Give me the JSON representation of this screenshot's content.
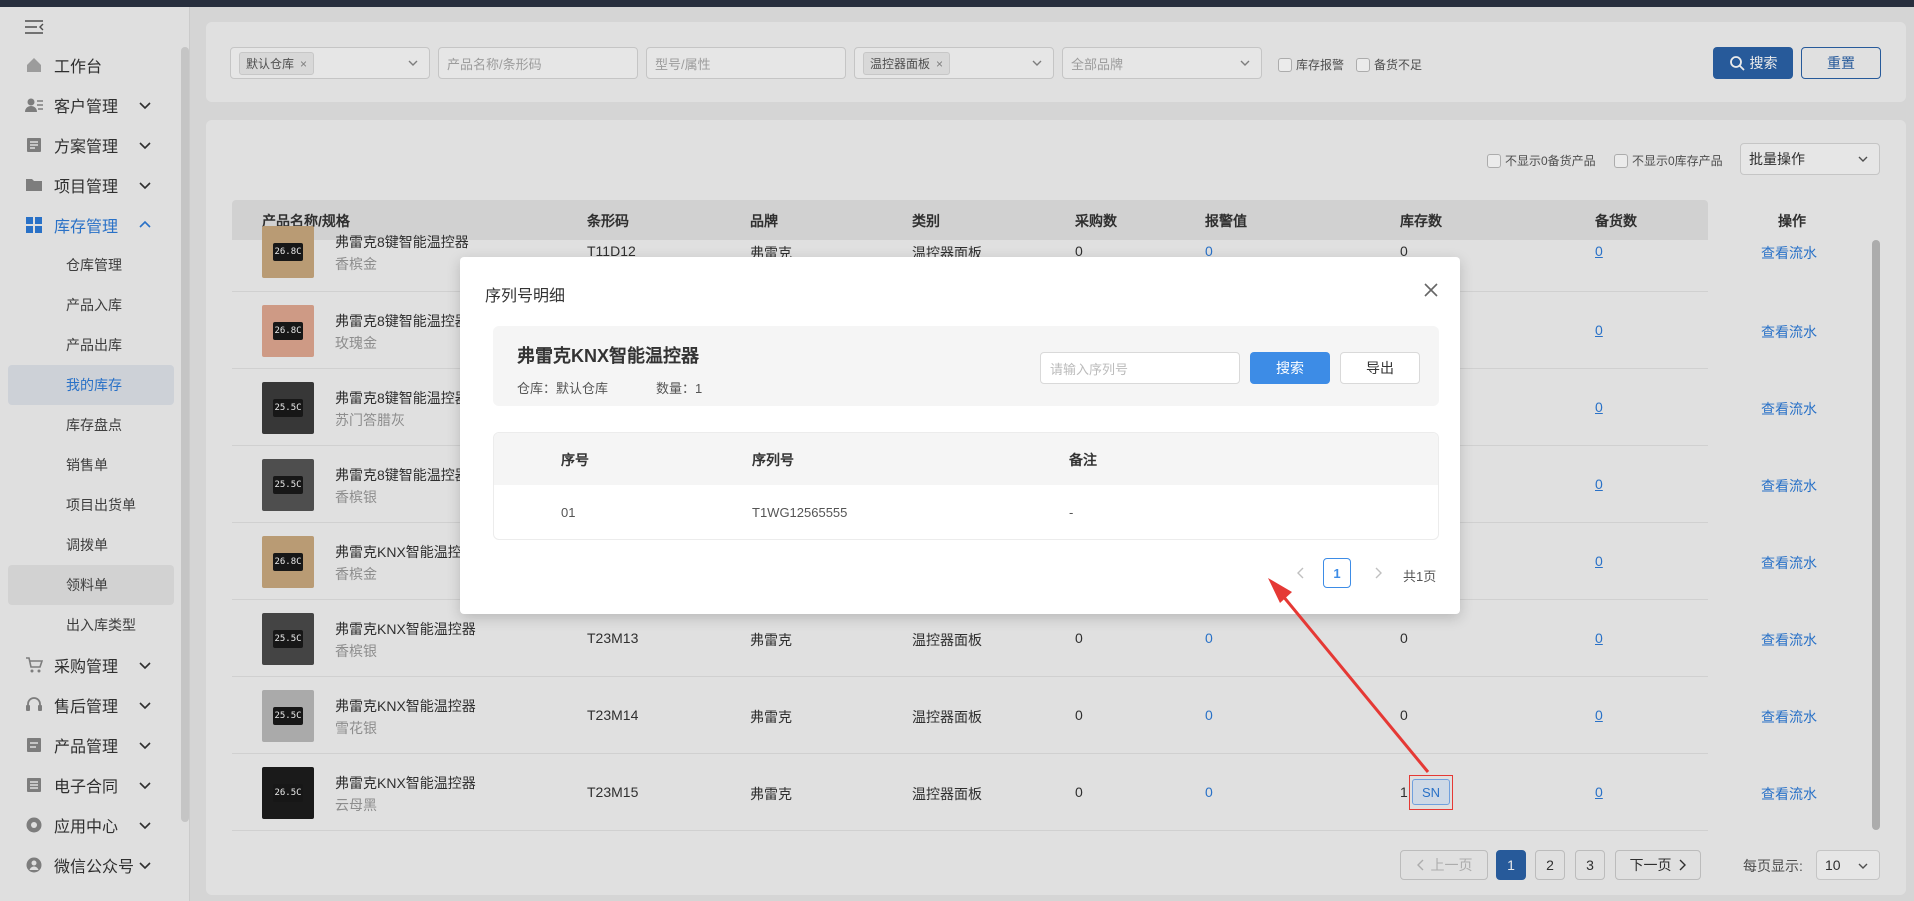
{
  "sidebar": {
    "menu": [
      {
        "label": "工作台",
        "icon": "home-icon",
        "has_chevron": false
      },
      {
        "label": "客户管理",
        "icon": "customer-icon",
        "has_chevron": true
      },
      {
        "label": "方案管理",
        "icon": "plan-icon",
        "has_chevron": true
      },
      {
        "label": "项目管理",
        "icon": "folder-icon",
        "has_chevron": true
      },
      {
        "label": "库存管理",
        "icon": "inventory-icon",
        "has_chevron": true,
        "expanded": true
      }
    ],
    "submenu": [
      {
        "label": "仓库管理"
      },
      {
        "label": "产品入库"
      },
      {
        "label": "产品出库"
      },
      {
        "label": "我的库存",
        "selected": true
      },
      {
        "label": "库存盘点"
      },
      {
        "label": "销售单"
      },
      {
        "label": "项目出货单"
      },
      {
        "label": "调拨单"
      },
      {
        "label": "领料单",
        "hover": true
      },
      {
        "label": "出入库类型"
      }
    ],
    "menu2": [
      {
        "label": "采购管理",
        "icon": "cart-icon"
      },
      {
        "label": "售后管理",
        "icon": "headset-icon"
      },
      {
        "label": "产品管理",
        "icon": "product-icon"
      },
      {
        "label": "电子合同",
        "icon": "contract-icon"
      },
      {
        "label": "应用中心",
        "icon": "app-icon"
      },
      {
        "label": "微信公众号",
        "icon": "wechat-icon"
      }
    ]
  },
  "filters": {
    "warehouse_tag": "默认仓库",
    "product_placeholder": "产品名称/条形码",
    "model_placeholder": "型号/属性",
    "category_tag": "温控器面板",
    "brand_placeholder": "全部品牌",
    "stock_alarm": "库存报警",
    "stock_short": "备货不足",
    "search_label": "搜索",
    "reset_label": "重置"
  },
  "list_options": {
    "hide_zero_reserve": "不显示0备货产品",
    "hide_zero_stock": "不显示0库存产品",
    "batch_label": "批量操作"
  },
  "table": {
    "headers": [
      "产品名称/规格",
      "条形码",
      "品牌",
      "类别",
      "采购数",
      "报警值",
      "库存数",
      "备货数",
      "操作"
    ],
    "rows": [
      {
        "name": "弗雷克8键智能温控器",
        "spec": "香槟金",
        "barcode": "T11D12",
        "brand": "弗雷克",
        "category": "温控器面板",
        "purchase": "0",
        "alarm": "0",
        "stock": "0",
        "reserve": "0",
        "action": "查看流水",
        "thumb_color": "#c9a97e",
        "display": "26.8C"
      },
      {
        "name": "弗雷克8键智能温控器",
        "spec": "玫瑰金",
        "barcode": "",
        "brand": "",
        "category": "",
        "purchase": "",
        "alarm": "",
        "stock": "",
        "reserve": "0",
        "action": "查看流水",
        "thumb_color": "#e0a891",
        "display": "26.8C"
      },
      {
        "name": "弗雷克8键智能温控器",
        "spec": "苏门答腊灰",
        "barcode": "",
        "brand": "",
        "category": "",
        "purchase": "",
        "alarm": "",
        "stock": "",
        "reserve": "0",
        "action": "查看流水",
        "thumb_color": "#3c3c3c",
        "display": "25.5C"
      },
      {
        "name": "弗雷克8键智能温控器",
        "spec": "香槟银",
        "barcode": "",
        "brand": "",
        "category": "",
        "purchase": "",
        "alarm": "",
        "stock": "",
        "reserve": "0",
        "action": "查看流水",
        "thumb_color": "#555555",
        "display": "25.5C"
      },
      {
        "name": "弗雷克KNX智能温控器",
        "spec": "香槟金",
        "barcode": "",
        "brand": "",
        "category": "",
        "purchase": "",
        "alarm": "",
        "stock": "",
        "reserve": "0",
        "action": "查看流水",
        "thumb_color": "#c9a97e",
        "display": "26.8C"
      },
      {
        "name": "弗雷克KNX智能温控器",
        "spec": "香槟银",
        "barcode": "T23M13",
        "brand": "弗雷克",
        "category": "温控器面板",
        "purchase": "0",
        "alarm": "0",
        "stock": "0",
        "reserve": "0",
        "action": "查看流水",
        "thumb_color": "#4a4a4a",
        "display": "25.5C"
      },
      {
        "name": "弗雷克KNX智能温控器",
        "spec": "雪花银",
        "barcode": "T23M14",
        "brand": "弗雷克",
        "category": "温控器面板",
        "purchase": "0",
        "alarm": "0",
        "stock": "0",
        "reserve": "0",
        "action": "查看流水",
        "thumb_color": "#b9b9b9",
        "display": "25.5C"
      },
      {
        "name": "弗雷克KNX智能温控器",
        "spec": "云母黑",
        "barcode": "T23M15",
        "brand": "弗雷克",
        "category": "温控器面板",
        "purchase": "0",
        "alarm": "0",
        "stock": "1",
        "reserve": "0",
        "action": "查看流水",
        "thumb_color": "#1d1d1d",
        "display": "26.5C"
      }
    ],
    "sn_label": "SN"
  },
  "pagination": {
    "prev": "上一页",
    "pages": [
      "1",
      "2",
      "3"
    ],
    "next": "下一页",
    "per_page_label": "每页显示:",
    "per_page_value": "10"
  },
  "modal": {
    "title": "序列号明细",
    "product_name": "弗雷克KNX智能温控器",
    "warehouse": "仓库：默认仓库",
    "quantity": "数量：1",
    "serial_placeholder": "请输入序列号",
    "search_label": "搜索",
    "export_label": "导出",
    "headers": [
      "序号",
      "序列号",
      "备注"
    ],
    "rows": [
      {
        "index": "01",
        "serial": "T1WG12565555",
        "remark": "-"
      }
    ],
    "current_page": "1",
    "total_pages": "共1页"
  },
  "colors": {
    "accent": "#2d7bd8",
    "primary_button": "#3d8ce6",
    "annotation": "#e53935"
  }
}
